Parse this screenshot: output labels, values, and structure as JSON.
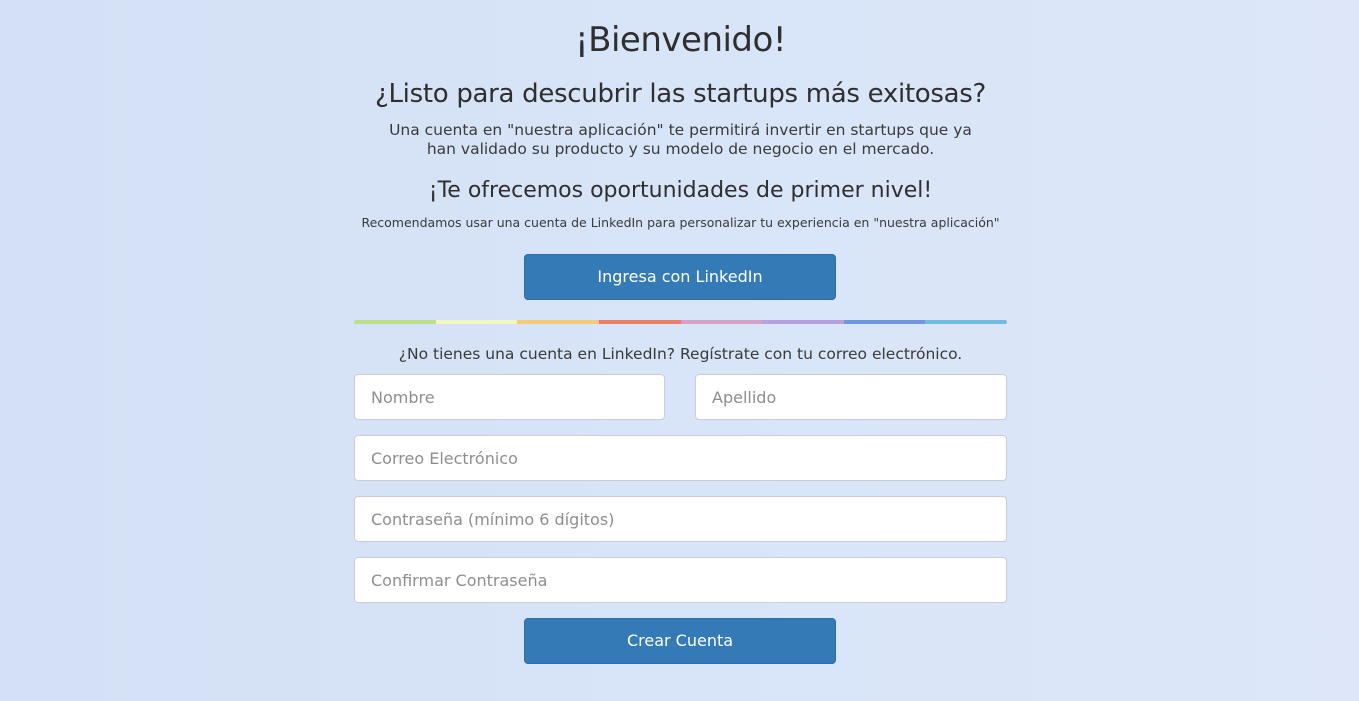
{
  "header": {
    "title": "¡Bienvenido!",
    "subtitle": "¿Listo para descubrir las startups más exitosas?",
    "description": "Una cuenta en \"nuestra aplicación\" te permitirá invertir en startups que ya han validado su producto y su modelo de negocio en el mercado.",
    "offer": "¡Te ofrecemos oportunidades de primer nivel!",
    "recommendation": "Recomendamos usar una cuenta de LinkedIn para personalizar tu experiencia en \"nuestra aplicación\""
  },
  "linkedin_button": {
    "label": "Ingresa con LinkedIn",
    "color": "#337ab7"
  },
  "divider": {
    "colors": [
      "#bcdf8a",
      "#f2f5c4",
      "#f7ca7a",
      "#ec7f6a",
      "#d4a2c8",
      "#b7a0e0",
      "#6f99de",
      "#6fbde2"
    ]
  },
  "signup": {
    "prompt": "¿No tienes una cuenta en LinkedIn? Regístrate con tu correo electrónico.",
    "fields": {
      "first_name": {
        "placeholder": "Nombre",
        "value": ""
      },
      "last_name": {
        "placeholder": "Apellido",
        "value": ""
      },
      "email": {
        "placeholder": "Correo Electrónico",
        "value": ""
      },
      "password": {
        "placeholder": "Contraseña (mínimo 6 dígitos)",
        "value": ""
      },
      "confirm_password": {
        "placeholder": "Confirmar Contraseña",
        "value": ""
      }
    },
    "create_button": {
      "label": "Crear Cuenta",
      "color": "#337ab7"
    }
  }
}
